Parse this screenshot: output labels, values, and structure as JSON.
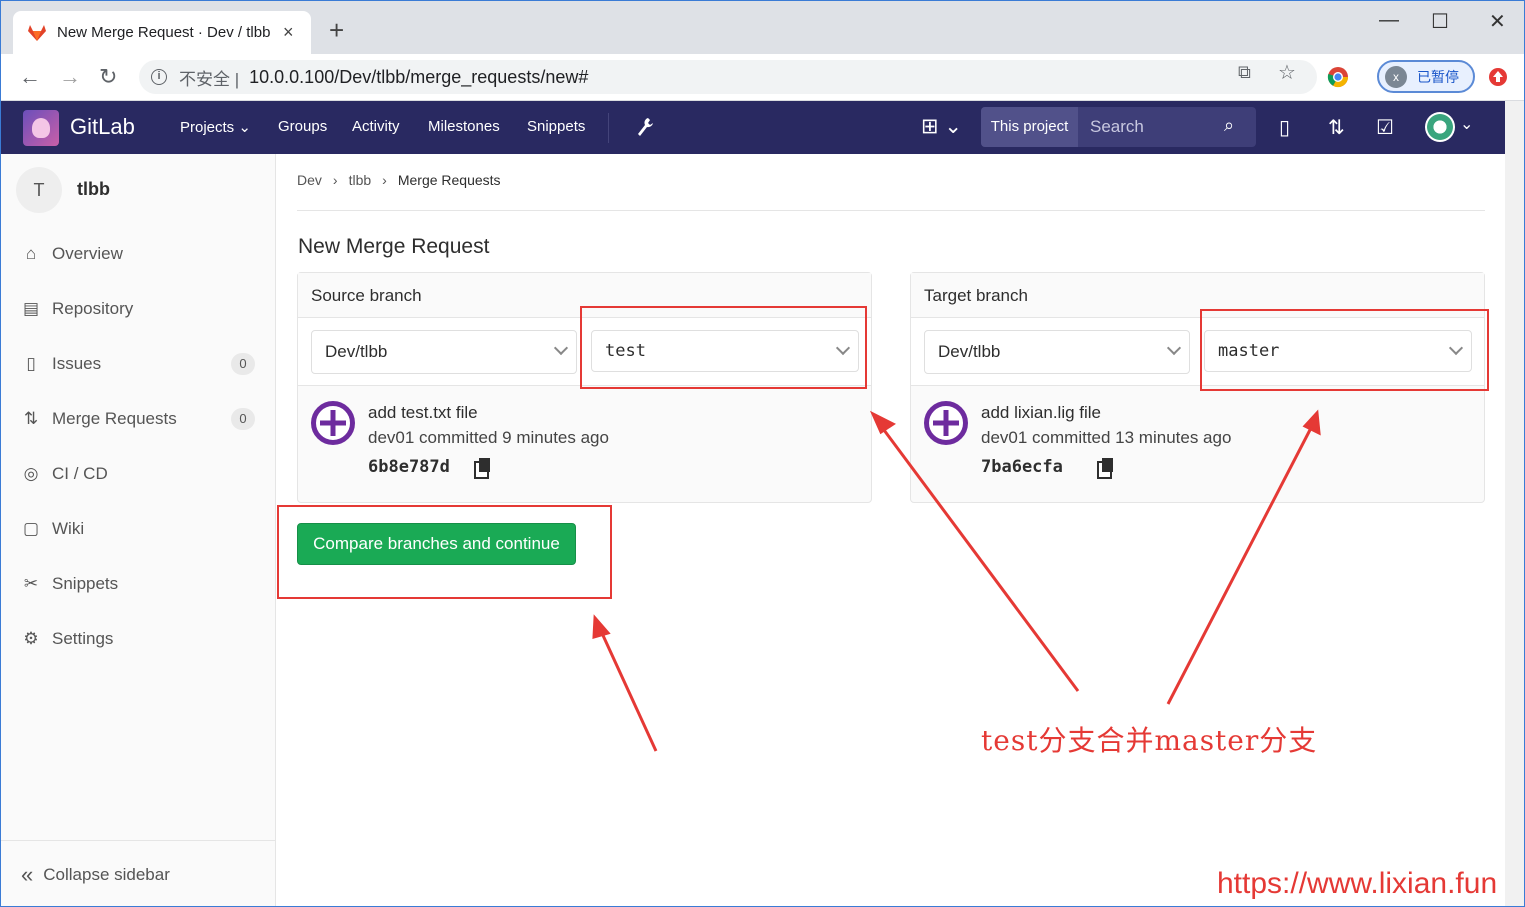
{
  "browser": {
    "tab_title": "New Merge Request · Dev / tlbb",
    "tab_close": "×",
    "new_tab": "+",
    "win_min": "—",
    "win_max": "☐",
    "win_close": "✕",
    "back": "←",
    "forward": "→",
    "reload": "↻",
    "info_glyph": "i",
    "insecure_label": "不安全 |",
    "url": "10.0.0.100/Dev/tlbb/merge_requests/new#",
    "translate_glyph": "⧉",
    "star_glyph": "☆",
    "profile_initial": "x",
    "profile_label": "已暂停"
  },
  "gitlab": {
    "name": "GitLab",
    "nav": [
      "Projects ⌄",
      "Groups",
      "Activity",
      "Milestones",
      "Snippets"
    ],
    "plus_glyph": "⊞ ⌄",
    "wrench_glyph": "🔧",
    "this_project": "This project",
    "search_placeholder": "Search",
    "search_glyph": "⌕",
    "icon_issues": "▯",
    "icon_mr": "⇅",
    "icon_todo": "☑",
    "avatar_chev": "⌄"
  },
  "sidebar": {
    "project_initial": "T",
    "project_name": "tlbb",
    "items": [
      {
        "label": "Overview",
        "icon": "⌂"
      },
      {
        "label": "Repository",
        "icon": "▤"
      },
      {
        "label": "Issues",
        "icon": "▯",
        "badge": "0"
      },
      {
        "label": "Merge Requests",
        "icon": "⇅",
        "badge": "0"
      },
      {
        "label": "CI / CD",
        "icon": "◎"
      },
      {
        "label": "Wiki",
        "icon": "▢"
      },
      {
        "label": "Snippets",
        "icon": "✂"
      },
      {
        "label": "Settings",
        "icon": "⚙"
      }
    ],
    "collapse_icon": "«",
    "collapse_label": "Collapse sidebar"
  },
  "breadcrumb": {
    "items": [
      "Dev",
      "tlbb",
      "Merge Requests"
    ],
    "sep": "›"
  },
  "page": {
    "title": "New Merge Request",
    "source": {
      "heading": "Source branch",
      "project": "Dev/tlbb",
      "branch": "test",
      "commit_title": "add test.txt file",
      "commit_meta": "dev01 committed 9 minutes ago",
      "sha": "6b8e787d"
    },
    "target": {
      "heading": "Target branch",
      "project": "Dev/tlbb",
      "branch": "master",
      "commit_title": "add lixian.lig file",
      "commit_meta": "dev01 committed 13 minutes ago",
      "sha": "7ba6ecfa"
    },
    "compare_button": "Compare branches and continue"
  },
  "annotation": {
    "text": "test分支合并master分支",
    "watermark": "https://www.lixian.fun",
    "color": "#e53935"
  }
}
